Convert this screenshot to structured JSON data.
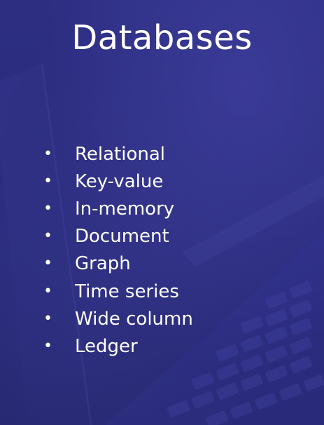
{
  "slide": {
    "title": "Databases",
    "items": [
      {
        "bullet": "•",
        "label": "Relational"
      },
      {
        "bullet": "•",
        "label": "Key-value"
      },
      {
        "bullet": "•",
        "label": "In-memory"
      },
      {
        "bullet": "•",
        "label": "Document"
      },
      {
        "bullet": "•",
        "label": "Graph"
      },
      {
        "bullet": "•",
        "label": "Time series"
      },
      {
        "bullet": "•",
        "label": "Wide column"
      },
      {
        "bullet": "•",
        "label": "Ledger"
      }
    ]
  },
  "colors": {
    "background": "#2b2c7e",
    "text": "#ffffff"
  }
}
